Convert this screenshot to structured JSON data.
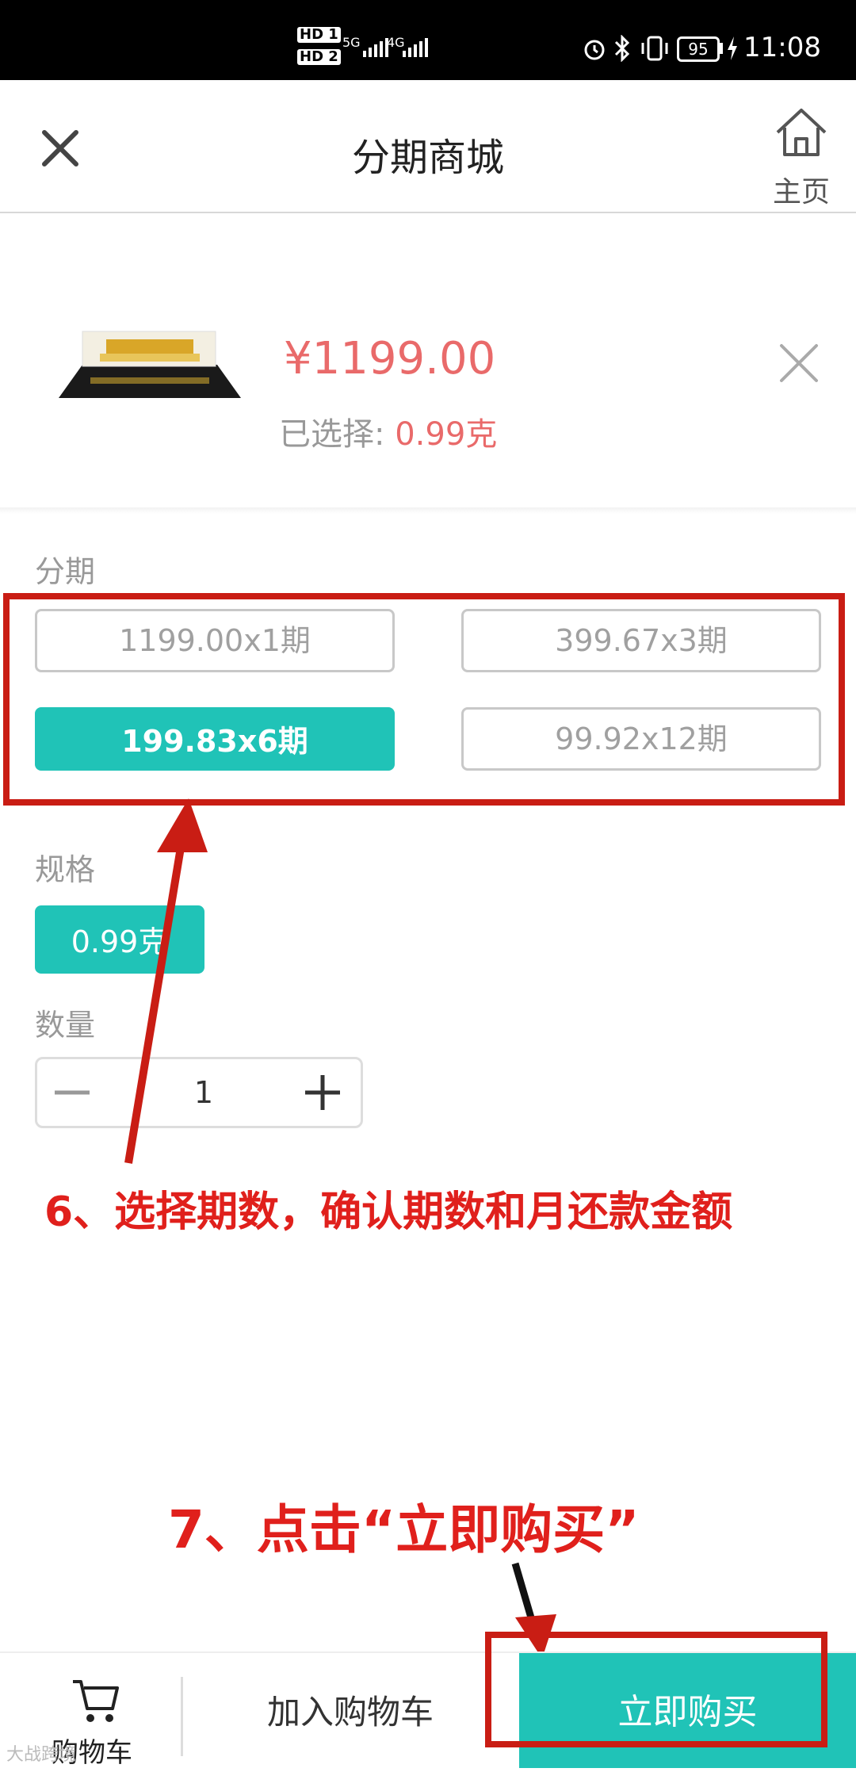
{
  "status_bar": {
    "sim1": "HD 1",
    "sim2": "HD 2",
    "net1": "5G",
    "net2": "4G",
    "battery": "95",
    "time": "11:08"
  },
  "header": {
    "title": "分期商城",
    "home_label": "主页"
  },
  "product": {
    "price": "¥1199.00",
    "selected_label": "已选择: ",
    "selected_value": "0.99克"
  },
  "installment": {
    "label": "分期",
    "options": [
      "1199.00x1期",
      "399.67x3期",
      "199.83x6期",
      "99.92x12期"
    ],
    "selected_index": 2
  },
  "spec": {
    "label": "规格",
    "options": [
      "0.99克"
    ]
  },
  "quantity": {
    "label": "数量",
    "value": "1"
  },
  "annotations": {
    "step6": "6、选择期数，确认期数和月还款金额",
    "step7": "7、点击“立即购买”"
  },
  "bottom_bar": {
    "cart_label": "购物车",
    "add_to_cart": "加入购物车",
    "buy_now": "立即购买",
    "watermark": "大战跨境"
  },
  "colors": {
    "accent": "#20c3b7",
    "price": "#e96a6a",
    "annotation": "#c91d14"
  }
}
